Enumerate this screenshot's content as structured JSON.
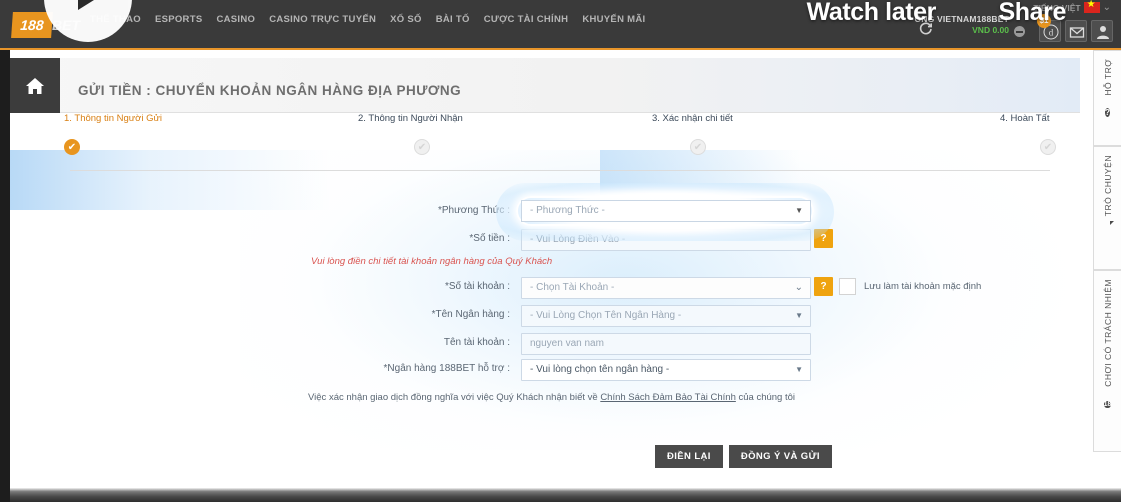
{
  "video_overlay": {
    "watch_later": "Watch later",
    "share": "Share",
    "play_icon": "play-icon"
  },
  "topnav": {
    "logo_number": "188",
    "logo_word": "BET",
    "items": [
      "THỂ THAO",
      "ESPORTS",
      "CASINO",
      "CASINO TRỰC TUYẾN",
      "XỔ SỐ",
      "BÀI TỐ",
      "CƯỢC TÀI CHÍNH",
      "KHUYẾN MÃI"
    ],
    "account_name": "ÔNG VIETNAM188BET",
    "balance": "VND 0.00",
    "refresh_icon": "refresh-icon",
    "collapse_icon": "minus-circle-icon",
    "buttons": [
      {
        "icon": "deposit-icon",
        "glyph": "d",
        "badge": "$1"
      },
      {
        "icon": "mail-icon",
        "glyph": "✉",
        "badge": ""
      },
      {
        "icon": "user-icon",
        "glyph": "👤",
        "badge": ""
      }
    ],
    "language": "TIẾNG VIỆT",
    "flag_icon": "vietnam-flag-icon",
    "chevron_icon": "chevron-down-icon",
    "accent_color": "#e8951f"
  },
  "page": {
    "home_icon": "home-icon",
    "title": "GỬI TIỀN : CHUYỂN KHOẢN NGÂN HÀNG ĐỊA PHƯƠNG"
  },
  "stepper": {
    "steps": [
      {
        "label": "1. Thông tin Người Gửi",
        "state": "active",
        "icon": "check-circle-icon"
      },
      {
        "label": "2. Thông tin Người Nhận",
        "state": "idle",
        "icon": "check-circle-icon"
      },
      {
        "label": "3. Xác nhận chi tiết",
        "state": "idle",
        "icon": "check-circle-icon"
      },
      {
        "label": "4. Hoàn Tất",
        "state": "idle",
        "icon": "check-circle-icon"
      }
    ]
  },
  "form": {
    "method_label": "*Phương Thức :",
    "method_value": "- Phương Thức -",
    "amount_label": "*Số tiền :",
    "amount_placeholder": "- Vui Lòng Điền Vào -",
    "amount_help": "?",
    "error_message": "Vui lòng điền chi tiết tài khoản ngân hàng của Quý Khách",
    "account_no_label": "*Số tài khoản :",
    "account_no_value": "- Chọn Tài Khoản -",
    "account_no_help": "?",
    "save_default_label": "Lưu làm tài khoản mặc định",
    "save_default_checked": false,
    "bank_name_label": "*Tên Ngân hàng :",
    "bank_name_value": "- Vui Lòng Chọn Tên Ngân Hàng -",
    "account_name_label": "Tên tài khoản :",
    "account_name_value": "nguyen van nam",
    "supported_bank_label": "*Ngân hàng 188BET hỗ trợ :",
    "supported_bank_value": "- Vui lòng chọn tên ngân hàng -",
    "terms_prefix": "Việc xác nhận giao dịch đồng nghĩa với việc Quý Khách nhận biết về ",
    "terms_link": "Chính Sách Đảm Bảo Tài Chính",
    "terms_suffix": " của chúng tôi",
    "reset_button": "ĐIỀN LẠI",
    "submit_button": "ĐỒNG Ý VÀ GỬI",
    "caret_icon": "chevron-down-icon"
  },
  "right_sidebar": {
    "tabs": [
      {
        "label": "HỖ TRỢ",
        "icon": "question-circle-icon",
        "glyph": "?"
      },
      {
        "label": "TRÒ CHUYỆN",
        "icon": "chat-icon",
        "glyph": ""
      },
      {
        "label": "CHƠI CÓ TRÁCH NHIỆM",
        "icon": "age-18-icon",
        "glyph": "18"
      }
    ]
  }
}
